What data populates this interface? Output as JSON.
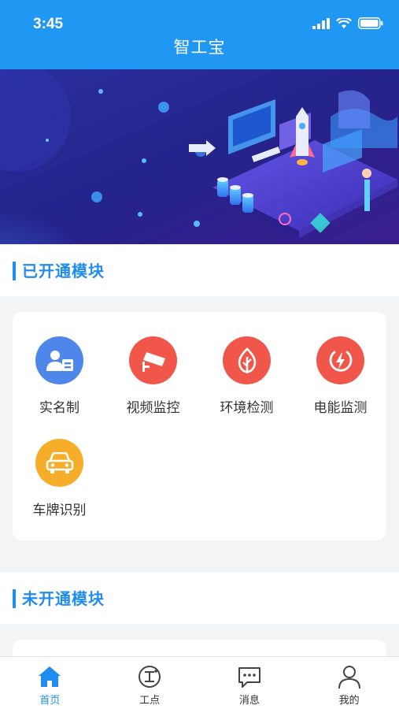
{
  "status_bar": {
    "time": "3:45"
  },
  "app": {
    "title": "智工宝"
  },
  "opened_section": {
    "title": "已开通模块",
    "modules": [
      {
        "label": "实名制",
        "icon": "id-card-icon",
        "color": "#4f86ea"
      },
      {
        "label": "视频监控",
        "icon": "camera-icon",
        "color": "#f0574a"
      },
      {
        "label": "环境检测",
        "icon": "leaf-icon",
        "color": "#f0574a"
      },
      {
        "label": "电能监测",
        "icon": "power-icon",
        "color": "#f0574a"
      },
      {
        "label": "车牌识别",
        "icon": "car-icon",
        "color": "#f6ad2a"
      }
    ]
  },
  "closed_section": {
    "title": "未开通模块"
  },
  "tabbar": {
    "items": [
      {
        "label": "首页",
        "icon": "home-icon",
        "active": true
      },
      {
        "label": "工点",
        "icon": "worksite-icon",
        "active": false
      },
      {
        "label": "消息",
        "icon": "message-icon",
        "active": false
      },
      {
        "label": "我的",
        "icon": "user-icon",
        "active": false
      }
    ],
    "active_color": "#1f8cf0"
  },
  "theme": {
    "primary": "#1f97f3",
    "accent": "#1f8cf0"
  }
}
